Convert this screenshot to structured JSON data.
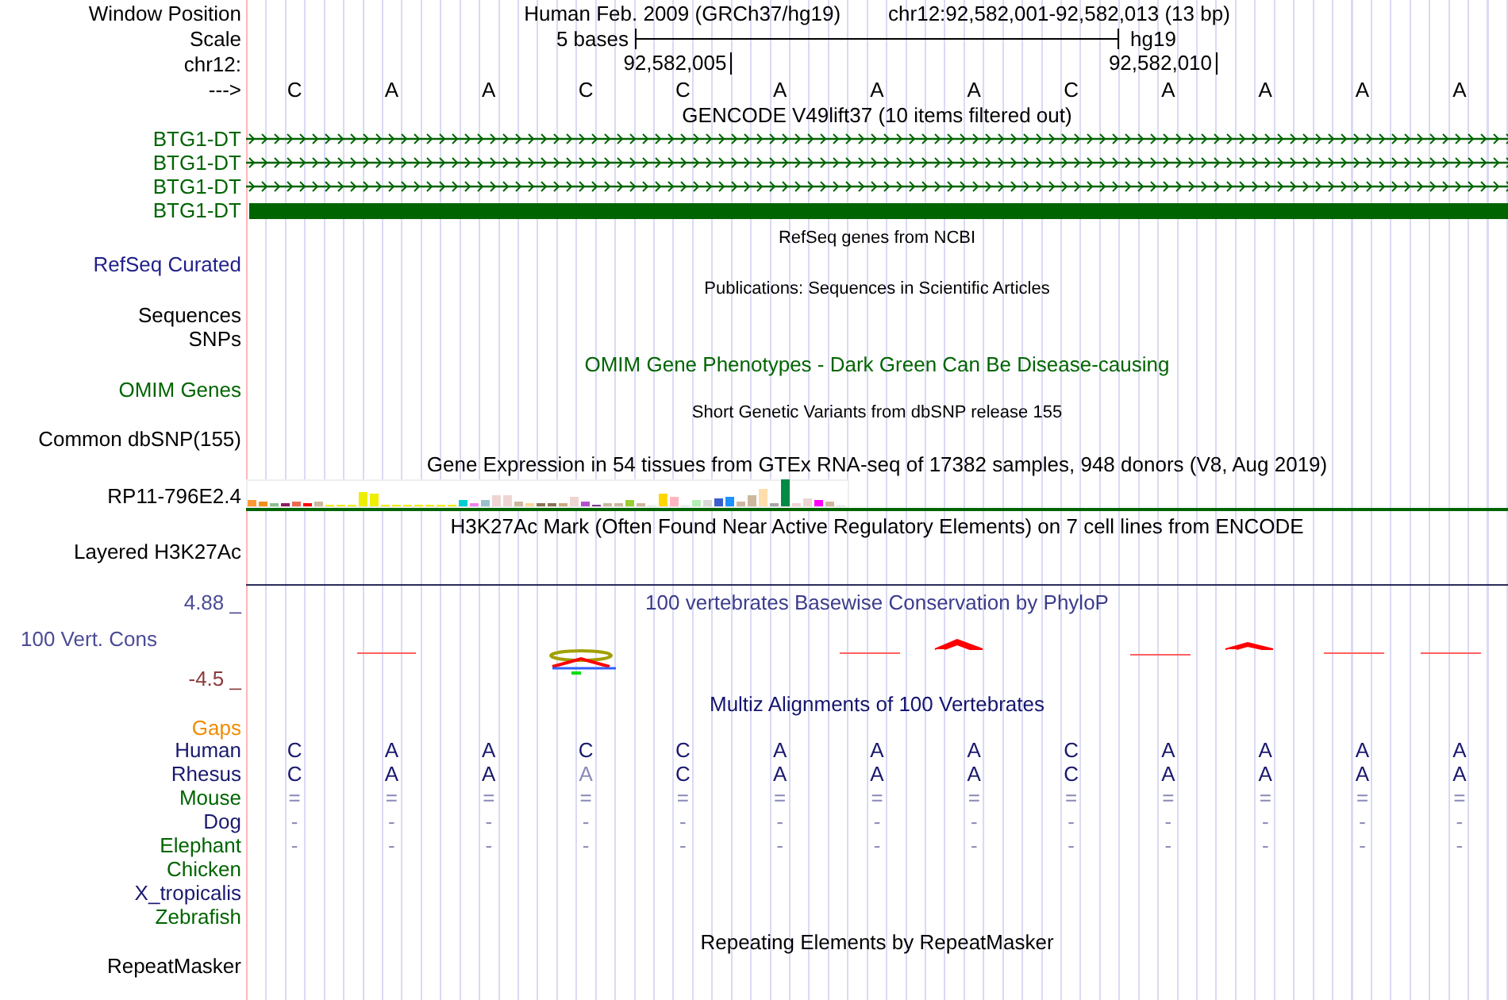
{
  "header": {
    "label": "Window Position",
    "assembly_title": "Human Feb. 2009 (GRCh37/hg19)",
    "position": "chr12:92,582,001-92,582,013 (13 bp)"
  },
  "scale": {
    "label": "Scale",
    "length": "5 bases",
    "assembly": "hg19"
  },
  "ruler": {
    "label": "chr12:",
    "ticks": [
      "92,582,005",
      "92,582,010"
    ]
  },
  "sequence": {
    "label": "--->",
    "bases": [
      "C",
      "A",
      "A",
      "C",
      "C",
      "A",
      "A",
      "A",
      "C",
      "A",
      "A",
      "A",
      "A"
    ]
  },
  "gencode": {
    "title": "GENCODE V49lift37 (10 items filtered out)",
    "transcripts": [
      {
        "label": "BTG1-DT",
        "kind": "intron"
      },
      {
        "label": "BTG1-DT",
        "kind": "intron"
      },
      {
        "label": "BTG1-DT",
        "kind": "intron"
      },
      {
        "label": "BTG1-DT",
        "kind": "exon"
      }
    ]
  },
  "refseq": {
    "title": "RefSeq genes from NCBI",
    "label": "RefSeq Curated"
  },
  "publications": {
    "title": "Publications: Sequences in Scientific Articles",
    "labels": [
      "Sequences",
      "SNPs"
    ]
  },
  "omim": {
    "title": "OMIM Gene Phenotypes - Dark Green Can Be Disease-causing",
    "label": "OMIM Genes"
  },
  "dbsnp": {
    "title": "Short Genetic Variants from dbSNP release 155",
    "label": "Common dbSNP(155)"
  },
  "gtex": {
    "title": "Gene Expression in 54 tissues from GTEx RNA-seq of 17382 samples, 948 donors (V8, Aug 2019)",
    "label": "RP11-796E2.4"
  },
  "h3k27ac": {
    "title": "H3K27Ac Mark (Often Found Near Active Regulatory Elements) on 7 cell lines from ENCODE",
    "label": "Layered H3K27Ac"
  },
  "phylop": {
    "title": "100 vertebrates Basewise Conservation by PhyloP",
    "label": "100 Vert. Cons",
    "max": "4.88 _",
    "min": "-4.5 _"
  },
  "multiz": {
    "title": "Multiz Alignments of 100 Vertebrates",
    "gaps_label": "Gaps",
    "species": [
      {
        "name": "Human",
        "color": "#191970",
        "bases": [
          "C",
          "A",
          "A",
          "C",
          "C",
          "A",
          "A",
          "A",
          "C",
          "A",
          "A",
          "A",
          "A"
        ]
      },
      {
        "name": "Rhesus",
        "color": "#191970",
        "bases": [
          "C",
          "A",
          "A",
          "A",
          "C",
          "A",
          "A",
          "A",
          "C",
          "A",
          "A",
          "A",
          "A"
        ]
      },
      {
        "name": "Mouse",
        "color": "#006400",
        "bases": [
          "=",
          "=",
          "=",
          "=",
          "=",
          "=",
          "=",
          "=",
          "=",
          "=",
          "=",
          "=",
          "="
        ]
      },
      {
        "name": "Dog",
        "color": "#191970",
        "bases": [
          "-",
          "-",
          "-",
          "-",
          "-",
          "-",
          "-",
          "-",
          "-",
          "-",
          "-",
          "-",
          "-"
        ]
      },
      {
        "name": "Elephant",
        "color": "#006400",
        "bases": [
          "-",
          "-",
          "-",
          "-",
          "-",
          "-",
          "-",
          "-",
          "-",
          "-",
          "-",
          "-",
          "-"
        ]
      },
      {
        "name": "Chicken",
        "color": "#006400"
      },
      {
        "name": "X_tropicalis",
        "color": "#191970"
      },
      {
        "name": "Zebrafish",
        "color": "#006400"
      }
    ]
  },
  "repeatmasker": {
    "title": "Repeating Elements by RepeatMasker",
    "label": "RepeatMasker"
  }
}
